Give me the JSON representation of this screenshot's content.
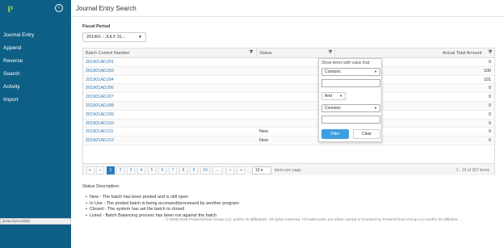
{
  "sidebar": {
    "logo": "P",
    "collapse_icon": "chevron-left-circle-icon",
    "items": [
      {
        "label": "Journal Entry"
      },
      {
        "label": "Append"
      },
      {
        "label": "Reverse"
      },
      {
        "label": "Search"
      },
      {
        "label": "Activity"
      },
      {
        "label": "Import"
      }
    ]
  },
  "header": {
    "title": "Journal Entry Search"
  },
  "fiscal_period": {
    "label": "Fiscal Period",
    "value": "201901 - JULY 31..."
  },
  "grid": {
    "columns": {
      "batch": "Batch Control Number",
      "status": "Status",
      "total": "Actual Total Amount"
    },
    "rows": [
      {
        "batch": "201901ADJ01",
        "status": "",
        "total": "0"
      },
      {
        "batch": "201901ADJ03",
        "status": "",
        "total": "100"
      },
      {
        "batch": "201901ADJ04",
        "status": "",
        "total": "101"
      },
      {
        "batch": "201901ADJ05",
        "status": "",
        "total": "0"
      },
      {
        "batch": "201901ADJ07",
        "status": "",
        "total": "0"
      },
      {
        "batch": "201901ADJ08",
        "status": "",
        "total": "0"
      },
      {
        "batch": "201901ADJ09",
        "status": "",
        "total": "0"
      },
      {
        "batch": "201901ADJ10",
        "status": "",
        "total": "0"
      },
      {
        "batch": "201901ADJ11",
        "status": "New",
        "total": "0"
      },
      {
        "batch": "201901ADJ12",
        "status": "New",
        "total": "0"
      }
    ],
    "pager": {
      "first": "⇤",
      "prev": "«",
      "pages": [
        "1",
        "2",
        "3",
        "4",
        "5",
        "6",
        "7",
        "8",
        "9",
        "10",
        "..."
      ],
      "next": "»",
      "last": "⇥",
      "per_page_value": "10",
      "per_page_label": "items per page",
      "info": "1 - 10 of 367 items"
    }
  },
  "filter_popup": {
    "title": "Show items with value that:",
    "op1": "Contains",
    "logic": "And",
    "op2": "Contains",
    "filter_btn": "Filter",
    "clear_btn": "Clear"
  },
  "status_description": {
    "title": "Status Description:",
    "items": [
      "New - The batch has been posted and is still open",
      "In Use - The posted batch is being accessed/processed by another program",
      "Closed - The system has set the batch to closed",
      "Listed - Batch Balancing process has been run against the batch"
    ]
  },
  "footer": {
    "text": "© 2005-2018 PowerSchool Group LLC and/or its affiliate(s). All rights reserved. All trademarks are either owned or licensed by PowerSchool Group LLC and/or its affiliates."
  },
  "statusbar": {
    "text": "javascript:void(0)"
  }
}
